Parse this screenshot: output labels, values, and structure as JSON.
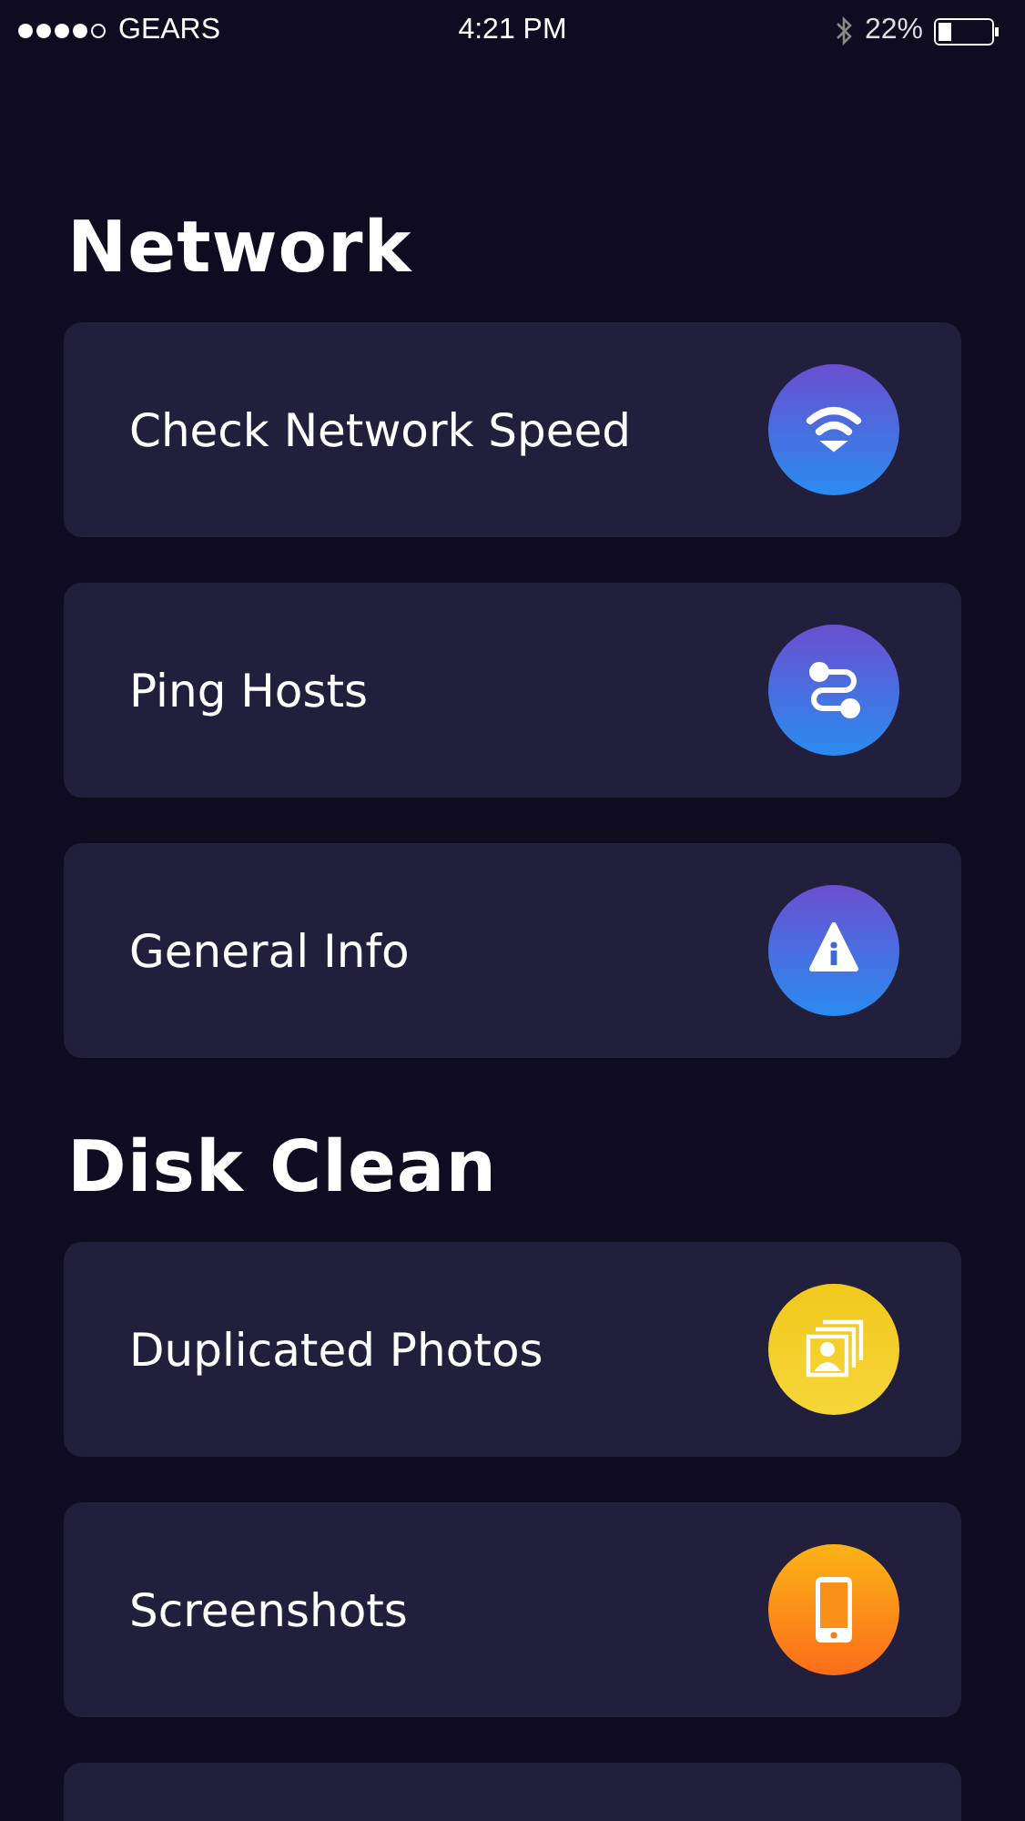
{
  "status_bar": {
    "carrier": "GEARS",
    "time": "4:21 PM",
    "battery": "22%"
  },
  "sections": [
    {
      "title": "Network",
      "items": [
        {
          "label": "Check Network Speed",
          "kind": "wifi"
        },
        {
          "label": "Ping Hosts",
          "kind": "route"
        },
        {
          "label": "General Info",
          "kind": "info"
        }
      ]
    },
    {
      "title": "Disk Clean",
      "items": [
        {
          "label": "Duplicated Photos",
          "kind": "photos"
        },
        {
          "label": "Screenshots",
          "kind": "phone"
        }
      ]
    }
  ]
}
